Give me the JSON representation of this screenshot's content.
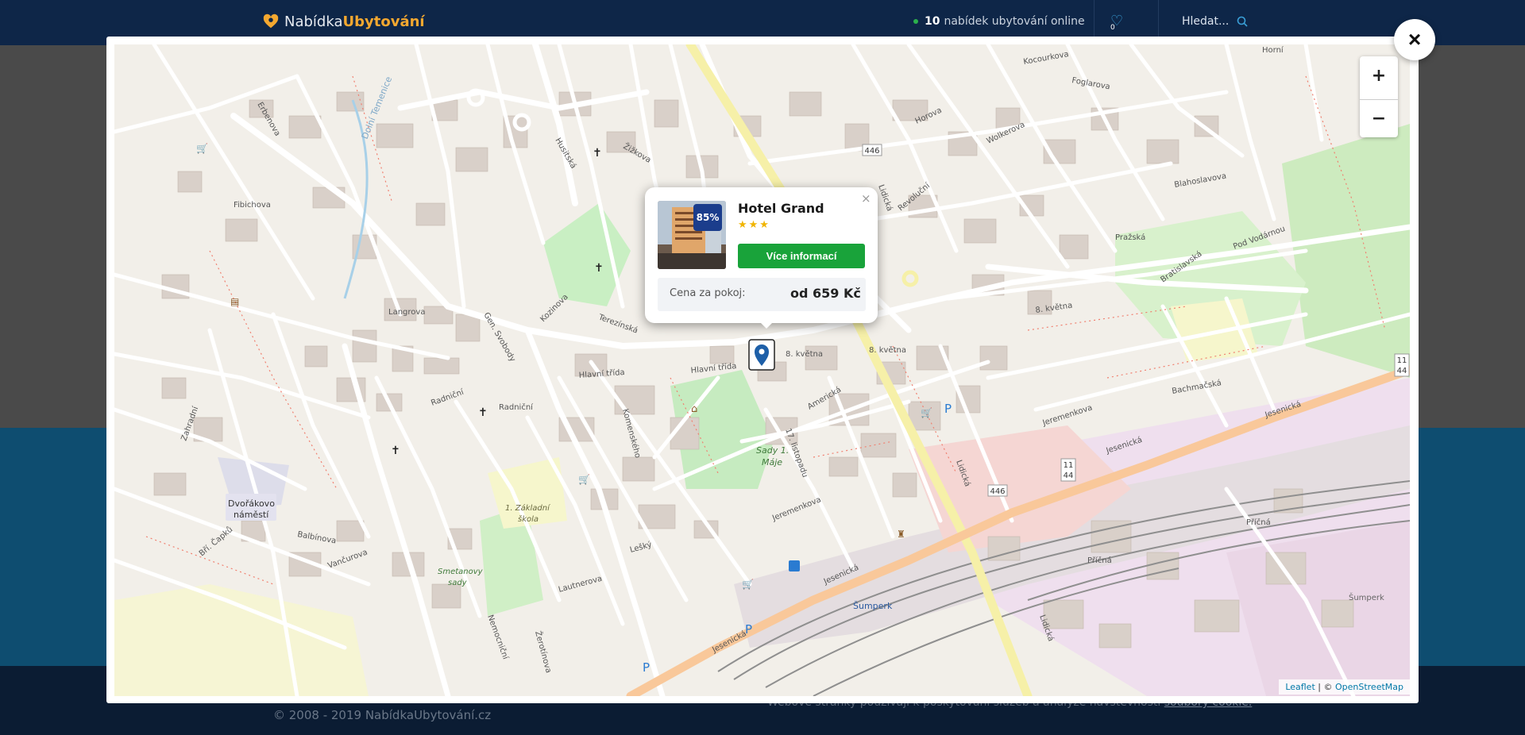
{
  "header": {
    "logo_plain": "Nabídka",
    "logo_bold": "Ubytování",
    "offers_count": "10",
    "offers_text": "nabídek ubytování online",
    "favorites_count": "0",
    "search_label": "Hledat..."
  },
  "footer": {
    "copyright": "© 2008 - 2019 NabídkaUbytování.cz",
    "cookie_text": "Webové stránky používají k poskytování služeb a analýze návštěvnosti",
    "cookie_link": "soubory cookie."
  },
  "modal": {
    "close_label": "×"
  },
  "map": {
    "zoom_in_label": "+",
    "zoom_out_label": "−",
    "attribution_leaflet": "Leaflet",
    "attribution_sep": " | © ",
    "attribution_osm": "OpenStreetMap",
    "labels": {
      "langrova": "Langrova",
      "hlavni_trida": "Hlavní třída",
      "hlavni_trida_2": "Hlavní třída",
      "radnicni": "Radniční",
      "gen_svobody": "Gen. Svobody",
      "kozinova": "Kozinova",
      "terezinska": "Terezínská",
      "bratri_capku": "Bří. Čapků",
      "dvorakovo": "Dvořákovo",
      "namesti": "náměstí",
      "sady": "Sady 1.",
      "maje": "Máje",
      "zakladni": "1. Základní",
      "skola": "škola",
      "smetanovy": "Smetanovy",
      "sady2": "sady",
      "jesenicka": "Jesenická",
      "jesenicka_2": "Jesenická",
      "jesenicka_3": "Jesenická",
      "jesenicka_4": "Jesenická",
      "jeremenkova": "Jeremenkova",
      "jeremenkova_2": "Jeremenkova",
      "listopadu": "17. listopadu",
      "americka": "Americká",
      "kvetna": "8. května",
      "kvetna_2": "8. května",
      "kvetna_3": "8. května",
      "lidicka": "Lidická",
      "lidicka_2": "Lidická",
      "lidicka_3": "Lidická",
      "revolucni": "Revoluční",
      "horova": "Horova",
      "wolkerova": "Wolkerova",
      "kocourkova": "Kocourkova",
      "foglarova": "Foglarova",
      "blahoslavova": "Blahoslavova",
      "prazska": "Pražská",
      "bratislavska": "Bratislavská",
      "pod_vodarnou": "Pod Vodárnou",
      "bachmacska": "Bachmačská",
      "prcna": "Příčná",
      "prcna_2": "Příčná",
      "sumperk": "Šumperk",
      "sumperk_2": "Šumperk",
      "erbenova": "Erbenova",
      "fibichova": "Fibichova",
      "zizkova": "Žižkova",
      "husitska": "Husitská",
      "komenskeho": "Komenského",
      "lesky": "Lešký",
      "lautnerova": "Lautnerova",
      "nemocnicni": "Nemocniční",
      "zerotinova": "Žerotínova",
      "zahradni": "Zahradní",
      "balbinova": "Balbínova",
      "vancurova": "Vančurova",
      "road_446": "446",
      "road_446_b": "446",
      "road_11": "11",
      "road_44": "44",
      "road_11b": "11",
      "road_44b": "44",
      "dolni_temenice": "Dolní Temenice",
      "horni": "Horní"
    }
  },
  "popup": {
    "hotel_name": "Hotel Grand",
    "rating": "85%",
    "stars": "★★★",
    "more_button": "Více informací",
    "price_label": "Cena za pokoj:",
    "price_value": "od 659 Kč",
    "close_label": "×"
  },
  "colors": {
    "header_bg": "#0e2648",
    "accent_orange": "#f4a830",
    "button_green": "#19a33a",
    "rating_blue": "#1b3d8c",
    "marker_blue": "#1d5fa8"
  }
}
